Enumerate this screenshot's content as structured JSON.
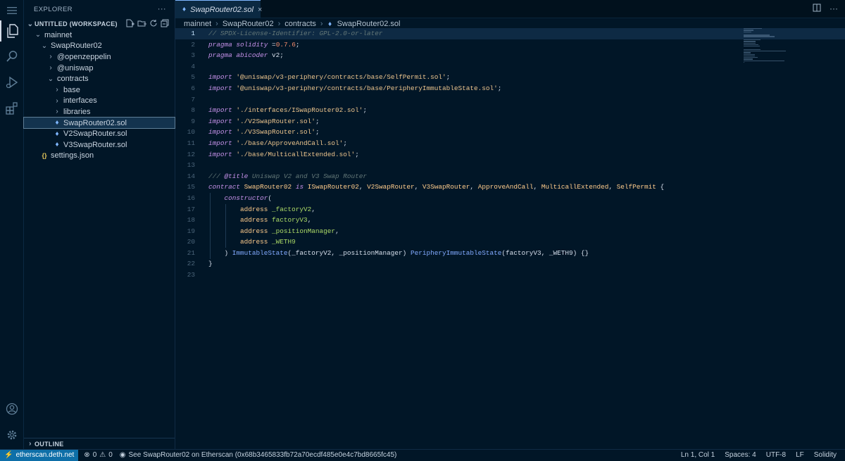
{
  "activity": {
    "items": [
      {
        "name": "menu-icon",
        "glyph": "≡"
      },
      {
        "name": "explorer-icon",
        "glyph": "❐"
      },
      {
        "name": "search-icon",
        "glyph": "⌕"
      },
      {
        "name": "run-debug-icon",
        "glyph": "▷"
      },
      {
        "name": "extensions-icon",
        "glyph": "⊞"
      }
    ],
    "bottom": [
      {
        "name": "account-icon",
        "glyph": "◯"
      },
      {
        "name": "settings-gear-icon",
        "glyph": "⚙"
      }
    ]
  },
  "sidebar": {
    "title": "EXPLORER",
    "more": "···",
    "workspace": "UNTITLED (WORKSPACE)",
    "tree": [
      {
        "label": "mainnet",
        "depth": 0,
        "kind": "folder-open"
      },
      {
        "label": "SwapRouter02",
        "depth": 1,
        "kind": "folder-open"
      },
      {
        "label": "@openzeppelin",
        "depth": 2,
        "kind": "folder"
      },
      {
        "label": "@uniswap",
        "depth": 2,
        "kind": "folder"
      },
      {
        "label": "contracts",
        "depth": 2,
        "kind": "folder-open"
      },
      {
        "label": "base",
        "depth": 3,
        "kind": "folder"
      },
      {
        "label": "interfaces",
        "depth": 3,
        "kind": "folder"
      },
      {
        "label": "libraries",
        "depth": 3,
        "kind": "folder"
      },
      {
        "label": "SwapRouter02.sol",
        "depth": 3,
        "kind": "sol",
        "selected": true
      },
      {
        "label": "V2SwapRouter.sol",
        "depth": 3,
        "kind": "sol"
      },
      {
        "label": "V3SwapRouter.sol",
        "depth": 3,
        "kind": "sol"
      },
      {
        "label": "settings.json",
        "depth": 1,
        "kind": "json"
      }
    ],
    "outline": "OUTLINE"
  },
  "editor": {
    "tab_label": "SwapRouter02.sol",
    "breadcrumb": [
      "mainnet",
      "SwapRouter02",
      "contracts",
      "SwapRouter02.sol"
    ],
    "lines": [
      [
        [
          "c-com",
          "// SPDX-License-Identifier: GPL-2.0-or-later"
        ]
      ],
      [
        [
          "c-kw",
          "pragma"
        ],
        [
          "c-id",
          " "
        ],
        [
          "c-kw",
          "solidity"
        ],
        [
          "c-id",
          " ="
        ],
        [
          "c-num",
          "0.7.6"
        ],
        [
          "c-id",
          ";"
        ]
      ],
      [
        [
          "c-kw",
          "pragma"
        ],
        [
          "c-id",
          " "
        ],
        [
          "c-kw",
          "abicoder"
        ],
        [
          "c-id",
          " v2;"
        ]
      ],
      [],
      [
        [
          "c-kw",
          "import"
        ],
        [
          "c-id",
          " "
        ],
        [
          "c-str",
          "'@uniswap/v3-periphery/contracts/base/SelfPermit.sol'"
        ],
        [
          "c-id",
          ";"
        ]
      ],
      [
        [
          "c-kw",
          "import"
        ],
        [
          "c-id",
          " "
        ],
        [
          "c-str",
          "'@uniswap/v3-periphery/contracts/base/PeripheryImmutableState.sol'"
        ],
        [
          "c-id",
          ";"
        ]
      ],
      [],
      [
        [
          "c-kw",
          "import"
        ],
        [
          "c-id",
          " "
        ],
        [
          "c-str",
          "'./interfaces/ISwapRouter02.sol'"
        ],
        [
          "c-id",
          ";"
        ]
      ],
      [
        [
          "c-kw",
          "import"
        ],
        [
          "c-id",
          " "
        ],
        [
          "c-str",
          "'./V2SwapRouter.sol'"
        ],
        [
          "c-id",
          ";"
        ]
      ],
      [
        [
          "c-kw",
          "import"
        ],
        [
          "c-id",
          " "
        ],
        [
          "c-str",
          "'./V3SwapRouter.sol'"
        ],
        [
          "c-id",
          ";"
        ]
      ],
      [
        [
          "c-kw",
          "import"
        ],
        [
          "c-id",
          " "
        ],
        [
          "c-str",
          "'./base/ApproveAndCall.sol'"
        ],
        [
          "c-id",
          ";"
        ]
      ],
      [
        [
          "c-kw",
          "import"
        ],
        [
          "c-id",
          " "
        ],
        [
          "c-str",
          "'./base/MulticallExtended.sol'"
        ],
        [
          "c-id",
          ";"
        ]
      ],
      [],
      [
        [
          "c-com",
          "/// "
        ],
        [
          "c-kw",
          "@title"
        ],
        [
          "c-com",
          " Uniswap V2 and V3 Swap Router"
        ]
      ],
      [
        [
          "c-kw",
          "contract"
        ],
        [
          "c-id",
          " "
        ],
        [
          "c-cls",
          "SwapRouter02"
        ],
        [
          "c-id",
          " "
        ],
        [
          "c-kw",
          "is"
        ],
        [
          "c-id",
          " "
        ],
        [
          "c-cls",
          "ISwapRouter02"
        ],
        [
          "c-id",
          ", "
        ],
        [
          "c-cls",
          "V2SwapRouter"
        ],
        [
          "c-id",
          ", "
        ],
        [
          "c-cls",
          "V3SwapRouter"
        ],
        [
          "c-id",
          ", "
        ],
        [
          "c-cls",
          "ApproveAndCall"
        ],
        [
          "c-id",
          ", "
        ],
        [
          "c-cls",
          "MulticallExtended"
        ],
        [
          "c-id",
          ", "
        ],
        [
          "c-cls",
          "SelfPermit"
        ],
        [
          "c-id",
          " {"
        ]
      ],
      [
        [
          "c-id",
          "    "
        ],
        [
          "c-kw",
          "constructor"
        ],
        [
          "c-id",
          "("
        ]
      ],
      [
        [
          "c-id",
          "        "
        ],
        [
          "c-cls",
          "address"
        ],
        [
          "c-id",
          " "
        ],
        [
          "c-var",
          "_factoryV2"
        ],
        [
          "c-id",
          ","
        ]
      ],
      [
        [
          "c-id",
          "        "
        ],
        [
          "c-cls",
          "address"
        ],
        [
          "c-id",
          " "
        ],
        [
          "c-var",
          "factoryV3"
        ],
        [
          "c-id",
          ","
        ]
      ],
      [
        [
          "c-id",
          "        "
        ],
        [
          "c-cls",
          "address"
        ],
        [
          "c-id",
          " "
        ],
        [
          "c-var",
          "_positionManager"
        ],
        [
          "c-id",
          ","
        ]
      ],
      [
        [
          "c-id",
          "        "
        ],
        [
          "c-cls",
          "address"
        ],
        [
          "c-id",
          " "
        ],
        [
          "c-var",
          "_WETH9"
        ]
      ],
      [
        [
          "c-id",
          "    ) "
        ],
        [
          "c-fn",
          "ImmutableState"
        ],
        [
          "c-id",
          "(_factoryV2, _positionManager) "
        ],
        [
          "c-fn",
          "PeripheryImmutableState"
        ],
        [
          "c-id",
          "(factoryV3, _WETH9) {}"
        ]
      ],
      [
        [
          "c-id",
          "}"
        ]
      ],
      []
    ]
  },
  "status": {
    "remote": "etherscan.deth.net",
    "errors": "0",
    "warnings": "0",
    "message": "See SwapRouter02 on Etherscan (0x68b3465833fb72a70ecdf485e0e4c7bd8665fc45)",
    "position": "Ln 1, Col 1",
    "spaces": "Spaces: 4",
    "encoding": "UTF-8",
    "eol": "LF",
    "language": "Solidity"
  }
}
